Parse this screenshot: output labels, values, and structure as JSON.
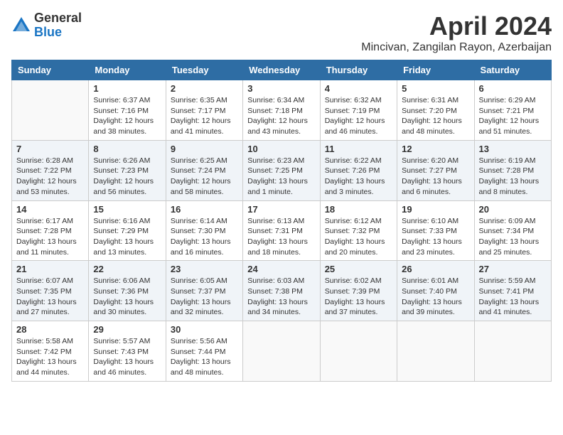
{
  "header": {
    "logo_general": "General",
    "logo_blue": "Blue",
    "title": "April 2024",
    "subtitle": "Mincivan, Zangilan Rayon, Azerbaijan"
  },
  "weekdays": [
    "Sunday",
    "Monday",
    "Tuesday",
    "Wednesday",
    "Thursday",
    "Friday",
    "Saturday"
  ],
  "weeks": [
    [
      {
        "day": "",
        "sunrise": "",
        "sunset": "",
        "daylight": "",
        "empty": true
      },
      {
        "day": "1",
        "sunrise": "Sunrise: 6:37 AM",
        "sunset": "Sunset: 7:16 PM",
        "daylight": "Daylight: 12 hours and 38 minutes."
      },
      {
        "day": "2",
        "sunrise": "Sunrise: 6:35 AM",
        "sunset": "Sunset: 7:17 PM",
        "daylight": "Daylight: 12 hours and 41 minutes."
      },
      {
        "day": "3",
        "sunrise": "Sunrise: 6:34 AM",
        "sunset": "Sunset: 7:18 PM",
        "daylight": "Daylight: 12 hours and 43 minutes."
      },
      {
        "day": "4",
        "sunrise": "Sunrise: 6:32 AM",
        "sunset": "Sunset: 7:19 PM",
        "daylight": "Daylight: 12 hours and 46 minutes."
      },
      {
        "day": "5",
        "sunrise": "Sunrise: 6:31 AM",
        "sunset": "Sunset: 7:20 PM",
        "daylight": "Daylight: 12 hours and 48 minutes."
      },
      {
        "day": "6",
        "sunrise": "Sunrise: 6:29 AM",
        "sunset": "Sunset: 7:21 PM",
        "daylight": "Daylight: 12 hours and 51 minutes."
      }
    ],
    [
      {
        "day": "7",
        "sunrise": "Sunrise: 6:28 AM",
        "sunset": "Sunset: 7:22 PM",
        "daylight": "Daylight: 12 hours and 53 minutes."
      },
      {
        "day": "8",
        "sunrise": "Sunrise: 6:26 AM",
        "sunset": "Sunset: 7:23 PM",
        "daylight": "Daylight: 12 hours and 56 minutes."
      },
      {
        "day": "9",
        "sunrise": "Sunrise: 6:25 AM",
        "sunset": "Sunset: 7:24 PM",
        "daylight": "Daylight: 12 hours and 58 minutes."
      },
      {
        "day": "10",
        "sunrise": "Sunrise: 6:23 AM",
        "sunset": "Sunset: 7:25 PM",
        "daylight": "Daylight: 13 hours and 1 minute."
      },
      {
        "day": "11",
        "sunrise": "Sunrise: 6:22 AM",
        "sunset": "Sunset: 7:26 PM",
        "daylight": "Daylight: 13 hours and 3 minutes."
      },
      {
        "day": "12",
        "sunrise": "Sunrise: 6:20 AM",
        "sunset": "Sunset: 7:27 PM",
        "daylight": "Daylight: 13 hours and 6 minutes."
      },
      {
        "day": "13",
        "sunrise": "Sunrise: 6:19 AM",
        "sunset": "Sunset: 7:28 PM",
        "daylight": "Daylight: 13 hours and 8 minutes."
      }
    ],
    [
      {
        "day": "14",
        "sunrise": "Sunrise: 6:17 AM",
        "sunset": "Sunset: 7:28 PM",
        "daylight": "Daylight: 13 hours and 11 minutes."
      },
      {
        "day": "15",
        "sunrise": "Sunrise: 6:16 AM",
        "sunset": "Sunset: 7:29 PM",
        "daylight": "Daylight: 13 hours and 13 minutes."
      },
      {
        "day": "16",
        "sunrise": "Sunrise: 6:14 AM",
        "sunset": "Sunset: 7:30 PM",
        "daylight": "Daylight: 13 hours and 16 minutes."
      },
      {
        "day": "17",
        "sunrise": "Sunrise: 6:13 AM",
        "sunset": "Sunset: 7:31 PM",
        "daylight": "Daylight: 13 hours and 18 minutes."
      },
      {
        "day": "18",
        "sunrise": "Sunrise: 6:12 AM",
        "sunset": "Sunset: 7:32 PM",
        "daylight": "Daylight: 13 hours and 20 minutes."
      },
      {
        "day": "19",
        "sunrise": "Sunrise: 6:10 AM",
        "sunset": "Sunset: 7:33 PM",
        "daylight": "Daylight: 13 hours and 23 minutes."
      },
      {
        "day": "20",
        "sunrise": "Sunrise: 6:09 AM",
        "sunset": "Sunset: 7:34 PM",
        "daylight": "Daylight: 13 hours and 25 minutes."
      }
    ],
    [
      {
        "day": "21",
        "sunrise": "Sunrise: 6:07 AM",
        "sunset": "Sunset: 7:35 PM",
        "daylight": "Daylight: 13 hours and 27 minutes."
      },
      {
        "day": "22",
        "sunrise": "Sunrise: 6:06 AM",
        "sunset": "Sunset: 7:36 PM",
        "daylight": "Daylight: 13 hours and 30 minutes."
      },
      {
        "day": "23",
        "sunrise": "Sunrise: 6:05 AM",
        "sunset": "Sunset: 7:37 PM",
        "daylight": "Daylight: 13 hours and 32 minutes."
      },
      {
        "day": "24",
        "sunrise": "Sunrise: 6:03 AM",
        "sunset": "Sunset: 7:38 PM",
        "daylight": "Daylight: 13 hours and 34 minutes."
      },
      {
        "day": "25",
        "sunrise": "Sunrise: 6:02 AM",
        "sunset": "Sunset: 7:39 PM",
        "daylight": "Daylight: 13 hours and 37 minutes."
      },
      {
        "day": "26",
        "sunrise": "Sunrise: 6:01 AM",
        "sunset": "Sunset: 7:40 PM",
        "daylight": "Daylight: 13 hours and 39 minutes."
      },
      {
        "day": "27",
        "sunrise": "Sunrise: 5:59 AM",
        "sunset": "Sunset: 7:41 PM",
        "daylight": "Daylight: 13 hours and 41 minutes."
      }
    ],
    [
      {
        "day": "28",
        "sunrise": "Sunrise: 5:58 AM",
        "sunset": "Sunset: 7:42 PM",
        "daylight": "Daylight: 13 hours and 44 minutes."
      },
      {
        "day": "29",
        "sunrise": "Sunrise: 5:57 AM",
        "sunset": "Sunset: 7:43 PM",
        "daylight": "Daylight: 13 hours and 46 minutes."
      },
      {
        "day": "30",
        "sunrise": "Sunrise: 5:56 AM",
        "sunset": "Sunset: 7:44 PM",
        "daylight": "Daylight: 13 hours and 48 minutes."
      },
      {
        "day": "",
        "sunrise": "",
        "sunset": "",
        "daylight": "",
        "empty": true
      },
      {
        "day": "",
        "sunrise": "",
        "sunset": "",
        "daylight": "",
        "empty": true
      },
      {
        "day": "",
        "sunrise": "",
        "sunset": "",
        "daylight": "",
        "empty": true
      },
      {
        "day": "",
        "sunrise": "",
        "sunset": "",
        "daylight": "",
        "empty": true
      }
    ]
  ]
}
